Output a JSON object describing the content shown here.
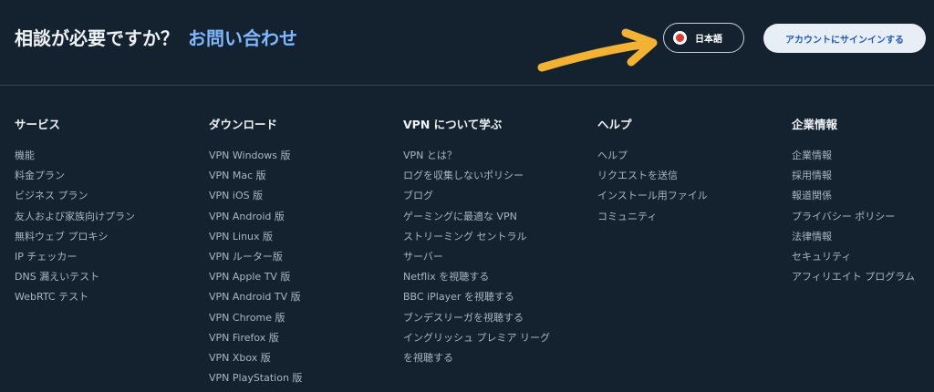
{
  "header": {
    "help_prompt": "相談が必要ですか？",
    "contact_link": "お問い合わせ",
    "language_label": "日本語",
    "signin_label": "アカウントにサインインする"
  },
  "colors": {
    "background": "#14222f",
    "accent_link": "#7fb8ff",
    "annotation_arrow": "#f2b233",
    "flag_red": "#e0372e"
  },
  "footer": {
    "services": {
      "title": "サービス",
      "items": [
        "機能",
        "料金プラン",
        "ビジネス プラン",
        "友人および家族向けプラン",
        "無料ウェブ プロキシ",
        "IP チェッカー",
        "DNS 漏えいテスト",
        "WebRTC テスト"
      ]
    },
    "downloads": {
      "title": "ダウンロード",
      "items": [
        "VPN Windows 版",
        "VPN Mac 版",
        "VPN iOS 版",
        "VPN Android 版",
        "VPN Linux 版",
        "VPN ルーター版",
        "VPN Apple TV 版",
        "VPN Android TV 版",
        "VPN Chrome 版",
        "VPN Firefox 版",
        "VPN Xbox 版",
        "VPN PlayStation 版"
      ]
    },
    "learn": {
      "title": "VPN について学ぶ",
      "items": [
        "VPN とは？",
        "ログを収集しないポリシー",
        "ブログ",
        "ゲーミングに最適な VPN",
        "ストリーミング セントラル",
        "サーバー",
        "Netflix を視聴する",
        "BBC iPlayer を視聴する",
        "ブンデスリーガを視聴する",
        "イングリッシュ プレミア リーグ",
        "を視聴する"
      ]
    },
    "help": {
      "title": "ヘルプ",
      "items": [
        "ヘルプ",
        "リクエストを送信",
        "インストール用ファイル",
        "コミュニティ"
      ]
    },
    "company": {
      "title": "企業情報",
      "items": [
        "企業情報",
        "採用情報",
        "報道関係",
        "プライバシー ポリシー",
        "法律情報",
        "セキュリティ",
        "アフィリエイト プログラム"
      ]
    }
  }
}
